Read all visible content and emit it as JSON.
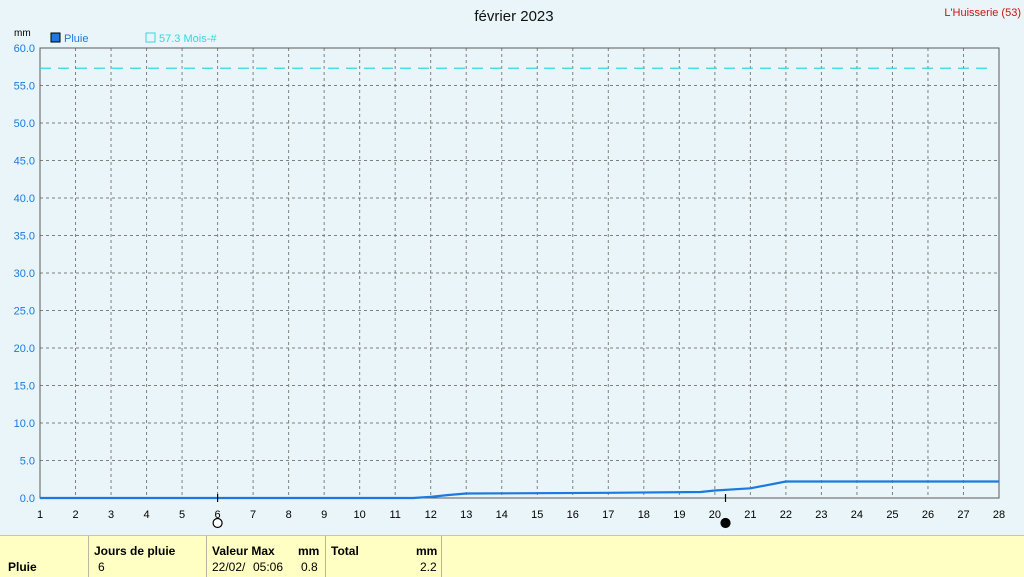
{
  "chart_data": {
    "type": "line",
    "title": "février 2023",
    "station": "L'Huisserie (53)",
    "y_unit": "mm",
    "ylim": [
      0,
      60
    ],
    "y_ticks": [
      "0.0",
      "5.0",
      "10.0",
      "15.0",
      "20.0",
      "25.0",
      "30.0",
      "35.0",
      "40.0",
      "45.0",
      "50.0",
      "55.0",
      "60.0"
    ],
    "xlim": [
      1,
      28
    ],
    "x_ticks": [
      "1",
      "2",
      "3",
      "4",
      "5",
      "6",
      "7",
      "8",
      "9",
      "10",
      "11",
      "12",
      "13",
      "14",
      "15",
      "16",
      "17",
      "18",
      "19",
      "20",
      "21",
      "22",
      "23",
      "24",
      "25",
      "26",
      "27",
      "28"
    ],
    "grid": true,
    "legend_placement": "top-left",
    "series": [
      {
        "name": "Pluie",
        "color": "#1a7ae0",
        "x": [
          1,
          11.5,
          12,
          12.5,
          13,
          17,
          19.6,
          20,
          21,
          22,
          28
        ],
        "y": [
          0,
          0,
          0.15,
          0.4,
          0.6,
          0.7,
          0.8,
          1.0,
          1.3,
          2.2,
          2.2
        ]
      }
    ],
    "reference_lines": [
      {
        "name": "57.3 Mois-#",
        "value": 57.3,
        "color": "#36d6e0",
        "style": "dashed"
      }
    ],
    "moon_phases": [
      {
        "x": 6,
        "phase": "full-moon",
        "color": "#ffffff"
      },
      {
        "x": 20.3,
        "phase": "new-moon",
        "color": "#000000"
      }
    ]
  },
  "footer": {
    "row_label": "Pluie",
    "rain_days_header": "Jours de pluie",
    "rain_days_value": "6",
    "max_header": "Valeur Max",
    "max_unit": "mm",
    "max_date": "22/02/",
    "max_time": "05:06",
    "max_value": "0.8",
    "total_header": "Total",
    "total_unit": "mm",
    "total_value": "2.2"
  }
}
